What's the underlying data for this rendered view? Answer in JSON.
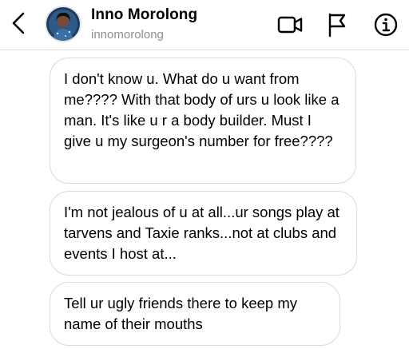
{
  "header": {
    "name": "Inno Morolong",
    "username": "innomorolong",
    "icons": {
      "back": "chevron-left-icon",
      "video": "video-camera-icon",
      "flag": "flag-icon",
      "info": "info-icon"
    }
  },
  "messages": [
    {
      "text": "I don't know u. What do u want from me???? With that body of urs u look like a man. It's like u r a body builder. Must I give u my surgeon's number for free????"
    },
    {
      "text": "I'm not jealous of u at all...ur songs play at tarvens and Taxie ranks...not at clubs and events I host at..."
    },
    {
      "text": "Tell ur ugly friends there to keep my name of their mouths"
    }
  ]
}
